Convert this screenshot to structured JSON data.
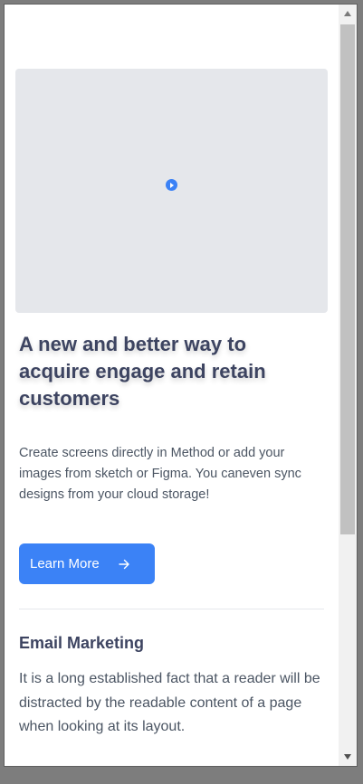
{
  "hero": {
    "play_icon": "play-circle-icon",
    "headline": "A new and better way to acquire engage and retain customers",
    "description": "Create screens directly in Method or add your images from sketch or Figma. You caneven sync designs from your cloud storage!",
    "cta_label": "Learn More",
    "cta_icon": "arrow-right-icon"
  },
  "feature": {
    "title": "Email Marketing",
    "text": "It is a long established fact that a reader will be distracted by the readable content of a page when looking at its layout."
  },
  "colors": {
    "accent": "#3b82f6",
    "heading": "#3d4461",
    "body": "#4b5563",
    "media_placeholder": "#e5e7eb"
  }
}
